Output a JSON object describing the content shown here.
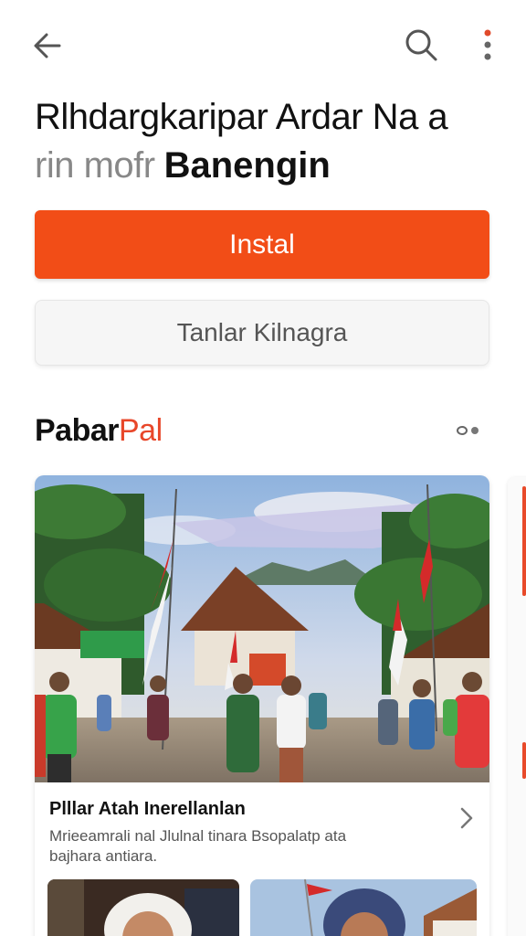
{
  "header": {
    "back_icon": "arrow-left-icon",
    "search_icon": "search-icon",
    "more_icon": "more-vertical-icon",
    "accent_color": "#e04a2a"
  },
  "title": {
    "line1": "Rlhdargkaripar Ardar Na a",
    "line2_muted": "rin mofr",
    "line2_bold": "Banengin"
  },
  "actions": {
    "install_label": "Instal",
    "install_color": "#f24d17",
    "secondary_label": "Tanlar Kilnagra"
  },
  "section": {
    "title_black": "Pabar",
    "title_red": "Pal",
    "dots_icon": "pagination-dots-icon"
  },
  "card": {
    "image_desc_icon": "village-flags-photo",
    "title": "Plllar Atah Inerellanlan",
    "description": "Mrieeamrali nal Jlulnal tinara Bsopalatp ata bajhara antiara.",
    "chevron_icon": "chevron-right-icon",
    "thumb1_icon": "woman-headscarf-photo",
    "thumb2_icon": "woman-hijab-photo"
  }
}
